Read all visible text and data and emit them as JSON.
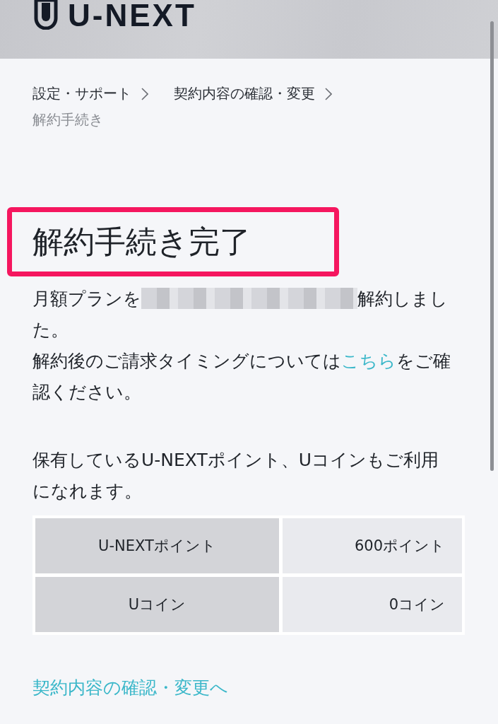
{
  "header": {
    "logo": "U-NEXT"
  },
  "breadcrumbs": [
    {
      "label": "設定・サポート",
      "current": false
    },
    {
      "label": "契約内容の確認・変更",
      "current": false
    },
    {
      "label": "解約手続き",
      "current": true
    }
  ],
  "title": {
    "text": "解約手続き完了",
    "highlighted": true
  },
  "cancel_message": {
    "before": "月額プランを",
    "redacted": true,
    "after": "解約しました。"
  },
  "billing_note": {
    "before": "解約後のご請求タイミングについては",
    "link": "こちら",
    "after": "をご確認ください。"
  },
  "points_note": "保有しているU-NEXTポイント、Uコインもご利用になれます。",
  "balances": [
    {
      "label": "U-NEXTポイント",
      "value": "600ポイント"
    },
    {
      "label": "Uコイン",
      "value": "0コイン"
    }
  ],
  "footer_link": "契約内容の確認・変更へ"
}
